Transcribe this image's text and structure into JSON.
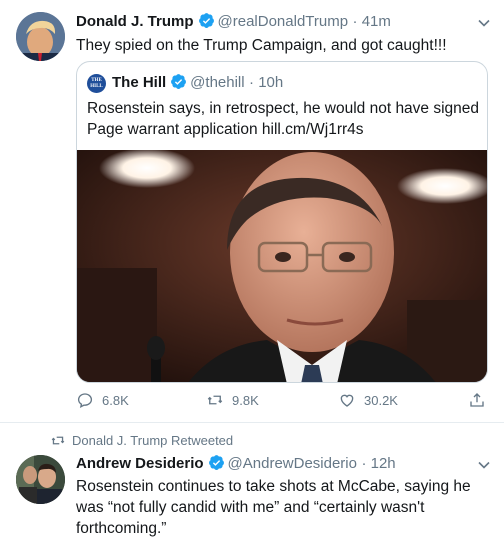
{
  "tweet1": {
    "name": "Donald J. Trump",
    "handle": "@realDonaldTrump",
    "time": "· 41m",
    "text": "They spied on the Trump Campaign, and got caught!!!",
    "quote": {
      "logo_text": "THE HILL",
      "name": "The Hill",
      "handle": "@thehill",
      "time": "· 10h",
      "text_line1": "Rosenstein says, in retrospect, he would not have signed",
      "text_line2": "Page warrant application hill.cm/Wj1rr4s"
    },
    "actions": {
      "replies": "6.8K",
      "retweets": "9.8K",
      "likes": "30.2K"
    }
  },
  "tweet2": {
    "retweeted_by": "Donald J. Trump Retweeted",
    "name": "Andrew Desiderio",
    "handle": "@AndrewDesiderio",
    "time": "· 12h",
    "text_line1": "Rosenstein continues to take shots at McCabe, saying he",
    "text_line2": "was “not fully candid with me” and “certainly wasn't",
    "text_line3": "forthcoming.”"
  },
  "colors": {
    "verified": "#1da1f2",
    "secondary_text": "#657786",
    "border": "#e6ecf0"
  }
}
